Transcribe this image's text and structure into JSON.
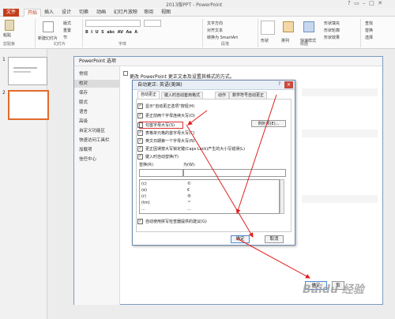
{
  "app": {
    "title": "2013版PPT - PowerPoint"
  },
  "ribbon": {
    "tabs": [
      "文件",
      "开始",
      "插入",
      "设计",
      "切换",
      "动画",
      "幻灯片放映",
      "审阅",
      "视图"
    ],
    "groups": [
      "剪贴板",
      "幻灯片",
      "字体",
      "段落",
      "绘图"
    ],
    "items": [
      "粘贴",
      "新建幻灯片",
      "版式",
      "重置",
      "节",
      "文字方向",
      "对齐文本",
      "转换为 SmartArt",
      "形状",
      "排列",
      "快速样式",
      "形状填充",
      "形状轮廓",
      "形状效果",
      "查找",
      "替换",
      "选择"
    ]
  },
  "slides": [
    "1",
    "2"
  ],
  "options_dialog": {
    "title": "PowerPoint 选项",
    "description": "更改 PowerPoint 更正文本及设置其格式的方式。",
    "nav": [
      "常规",
      "校对",
      "保存",
      "版式",
      "语言",
      "高级",
      "自定义功能区",
      "快速访问工具栏",
      "加载项",
      "信任中心"
    ],
    "selected_nav": "校对",
    "ok_label": "确定",
    "cancel_label": "取"
  },
  "autocorrect_dialog": {
    "title": "自动更正: 英语(美国)",
    "help": "?",
    "close": "✕",
    "tabs": [
      "自动更正",
      "键入时自动套用格式",
      "动作",
      "数学符号自动更正"
    ],
    "options": [
      {
        "label": "显示\"自动更正选项\"按钮(H)",
        "checked": true
      },
      {
        "label": "更正前两个字母连续大写(O)",
        "checked": true
      },
      {
        "label": "句首字母大写(S)",
        "checked": false
      },
      {
        "label": "表格单元格的首字母大写(C)",
        "checked": true
      },
      {
        "label": "英文日期第一个字母大写(N)",
        "checked": true
      },
      {
        "label": "更正因误按大写锁定键(Caps Lock)产生的大小写错误(L)",
        "checked": true
      },
      {
        "label": "键入时自动替换(T)",
        "checked": true
      }
    ],
    "exceptions_label": "例外项(E)...",
    "replace_label": "替换(R):",
    "with_label": "为(W):",
    "replacements": [
      {
        "from": "(c)",
        "to": "©"
      },
      {
        "from": "(e)",
        "to": "€"
      },
      {
        "from": "(r)",
        "to": "®"
      },
      {
        "from": "(tm)",
        "to": "™"
      },
      {
        "from": "...",
        "to": "…"
      }
    ],
    "spell_suggest": {
      "label": "自动使用拼写检查器提供的建议(G)",
      "checked": true
    },
    "ok_label": "确定",
    "cancel_label": "取消"
  },
  "watermark": "Baidu 经验"
}
